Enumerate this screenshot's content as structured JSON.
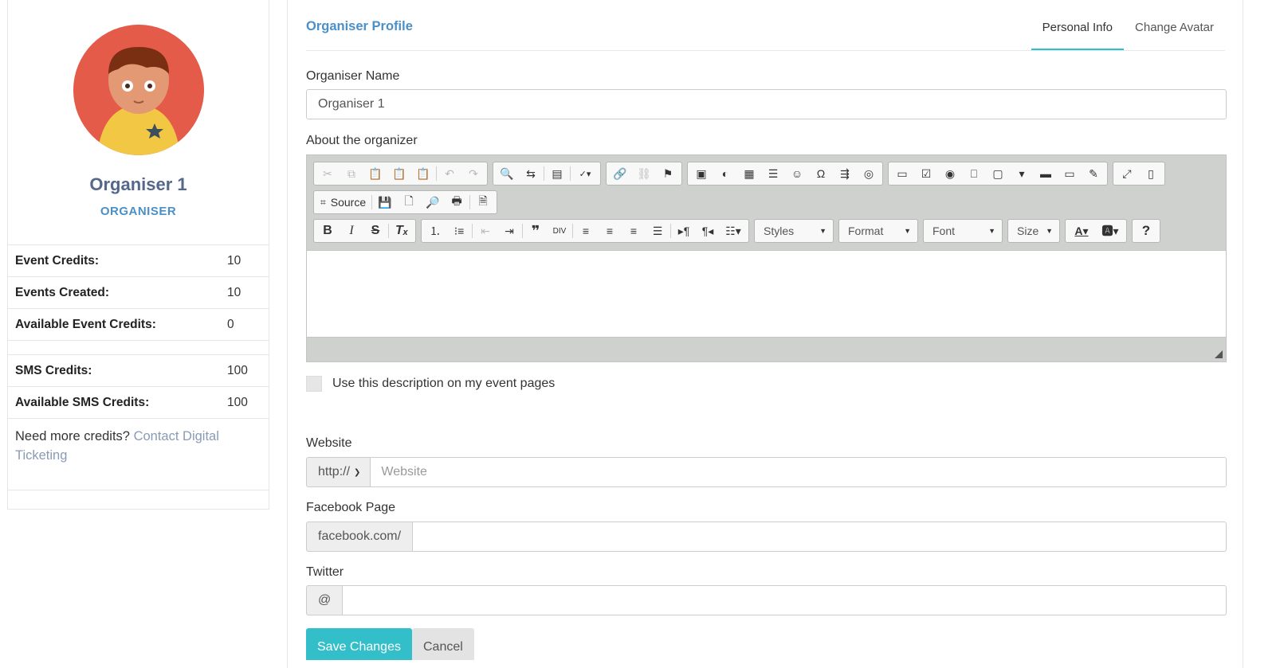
{
  "sidebar": {
    "name": "Organiser 1",
    "role": "ORGANISER",
    "stats": [
      {
        "label": "Event Credits:",
        "value": "10"
      },
      {
        "label": "Events Created:",
        "value": "10"
      },
      {
        "label": "Available Event Credits:",
        "value": "0"
      }
    ],
    "sms_stats": [
      {
        "label": "SMS Credits:",
        "value": "100"
      },
      {
        "label": "Available SMS Credits:",
        "value": "100"
      }
    ],
    "credits_prompt": "Need more credits?",
    "credits_link": "Contact Digital Ticketing"
  },
  "header": {
    "title": "Organiser Profile",
    "tabs": [
      {
        "label": "Personal Info",
        "active": true
      },
      {
        "label": "Change Avatar",
        "active": false
      }
    ],
    "accent_color": "#2fbfc9"
  },
  "form": {
    "name_label": "Organiser Name",
    "name_value": "Organiser 1",
    "about_label": "About the organizer",
    "editor": {
      "source_label": "Source",
      "styles_label": "Styles",
      "format_label": "Format",
      "font_label": "Font",
      "size_label": "Size"
    },
    "use_description_label": "Use this description on my event pages",
    "website_label": "Website",
    "website_protocol": "http://",
    "website_placeholder": "Website",
    "facebook_label": "Facebook Page",
    "facebook_prefix": "facebook.com/",
    "twitter_label": "Twitter",
    "twitter_prefix": "@",
    "save_label": "Save Changes",
    "cancel_label": "Cancel"
  },
  "icons": [
    "cut-icon",
    "copy-icon",
    "paste-icon",
    "paste-text-icon",
    "paste-word-icon",
    "undo-icon",
    "redo-icon",
    "find-icon",
    "replace-icon",
    "select-all-icon",
    "spellcheck-icon",
    "link-icon",
    "unlink-icon",
    "anchor-icon",
    "image-icon",
    "flash-icon",
    "table-icon",
    "horizontal-rule-icon",
    "smiley-icon",
    "special-char-icon",
    "page-break-icon",
    "iframe-icon",
    "form-icon",
    "checkbox-icon",
    "radio-icon",
    "textfield-icon",
    "textarea-icon",
    "select-icon",
    "button-icon",
    "image-button-icon",
    "hidden-field-icon",
    "maximize-icon",
    "show-blocks-icon",
    "source-icon",
    "save-icon",
    "new-page-icon",
    "preview-icon",
    "print-icon",
    "templates-icon",
    "bold-icon",
    "italic-icon",
    "strike-icon",
    "remove-format-icon",
    "numbered-list-icon",
    "bulleted-list-icon",
    "outdent-icon",
    "indent-icon",
    "blockquote-icon",
    "div-icon",
    "align-left-icon",
    "align-center-icon",
    "align-right-icon",
    "justify-icon",
    "ltr-icon",
    "rtl-icon",
    "language-icon",
    "text-color-icon",
    "bg-color-icon",
    "help-icon"
  ]
}
